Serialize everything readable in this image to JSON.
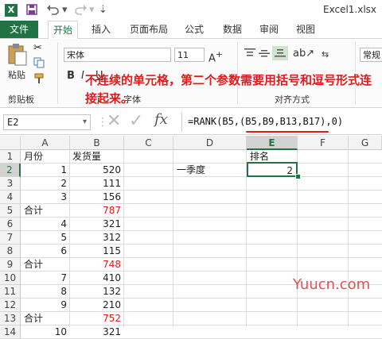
{
  "window": {
    "title": "Excel1.xlsx",
    "logo_text": "X"
  },
  "quick_access": {
    "save_icon": "save-icon",
    "undo_icon": "undo-icon",
    "redo_icon": "redo-icon"
  },
  "tabs": {
    "file": "文件",
    "home": "开始",
    "insert": "插入",
    "page_layout": "页面布局",
    "formulas": "公式",
    "data": "数据",
    "review": "审阅",
    "view": "视图"
  },
  "ribbon": {
    "paste": "粘贴",
    "clipboard_group": "剪贴板",
    "font_name": "宋体",
    "font_size": "11",
    "font_group": "字体",
    "bold": "B",
    "italic": "I",
    "underline": "U",
    "align_group": "对齐方式",
    "number_format": "常规"
  },
  "annotation": "不连续的单元格，第二个参数需要用括号和逗号形式连接起来。",
  "formula_bar": {
    "name_box": "E2",
    "fx": "fx",
    "formula": "=RANK(B5,(B5,B9,B13,B17),0)"
  },
  "columns": [
    "A",
    "B",
    "C",
    "D",
    "E",
    "F",
    "G"
  ],
  "rows": [
    {
      "n": "1",
      "a": "月份",
      "b": "发货量",
      "b_red": false
    },
    {
      "n": "2",
      "a": "1",
      "b": "520",
      "b_red": false
    },
    {
      "n": "3",
      "a": "2",
      "b": "111",
      "b_red": false
    },
    {
      "n": "4",
      "a": "3",
      "b": "156",
      "b_red": false
    },
    {
      "n": "5",
      "a": "合计",
      "b": "787",
      "b_red": true
    },
    {
      "n": "6",
      "a": "4",
      "b": "321",
      "b_red": false
    },
    {
      "n": "7",
      "a": "5",
      "b": "312",
      "b_red": false
    },
    {
      "n": "8",
      "a": "6",
      "b": "115",
      "b_red": false
    },
    {
      "n": "9",
      "a": "合计",
      "b": "748",
      "b_red": true
    },
    {
      "n": "10",
      "a": "7",
      "b": "410",
      "b_red": false
    },
    {
      "n": "11",
      "a": "8",
      "b": "132",
      "b_red": false
    },
    {
      "n": "12",
      "a": "9",
      "b": "210",
      "b_red": false
    },
    {
      "n": "13",
      "a": "合计",
      "b": "752",
      "b_red": true
    },
    {
      "n": "14",
      "a": "10",
      "b": "321",
      "b_red": false
    }
  ],
  "extra_cells": {
    "e1": "排名",
    "d2": "一季度",
    "e2": "2"
  },
  "watermark": "Yuucn.com",
  "colors": {
    "excel_green": "#217346",
    "red": "#e01b1b",
    "selection": "#217346"
  }
}
